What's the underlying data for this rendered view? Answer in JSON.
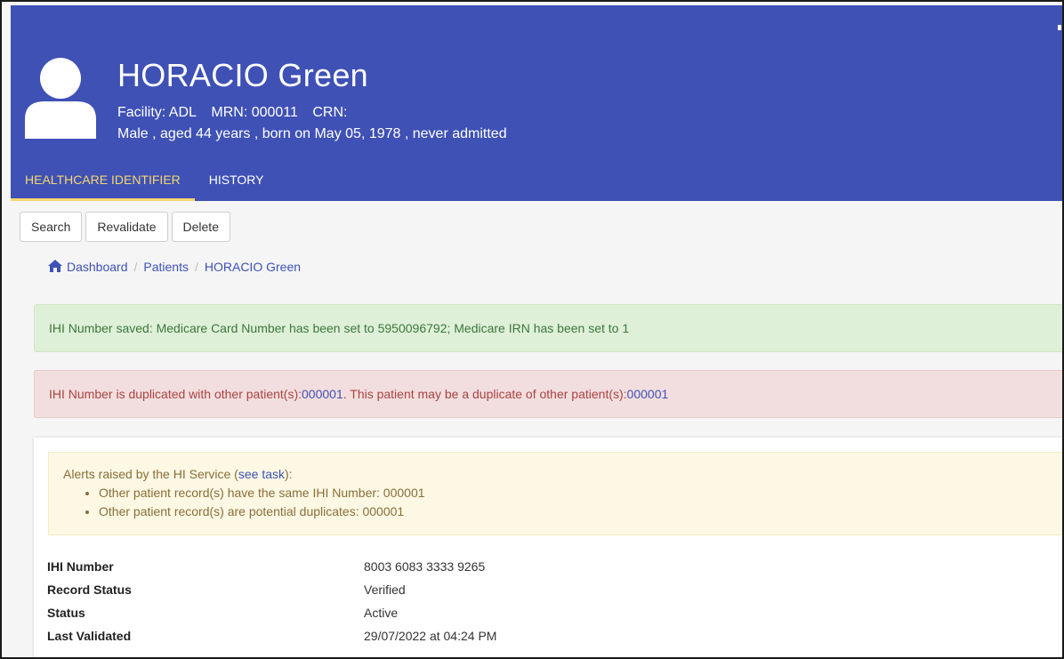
{
  "patient": {
    "name": "HORACIO Green",
    "facility": "Facility: ADL",
    "mrn": "MRN: 000011",
    "crn": "CRN:",
    "summary": "Male , aged 44 years , born on May 05, 1978 , never admitted"
  },
  "tabs": [
    {
      "label": "HEALTHCARE IDENTIFIER",
      "active": true
    },
    {
      "label": "HISTORY",
      "active": false
    }
  ],
  "toolbar": {
    "search_label": "Search",
    "revalidate_label": "Revalidate",
    "delete_label": "Delete"
  },
  "breadcrumb": {
    "home": "Dashboard",
    "patients": "Patients",
    "current": "HORACIO Green"
  },
  "alerts": {
    "success": "IHI Number saved: Medicare Card Number has been set to 5950096792; Medicare IRN has been set to 1",
    "danger_prefix": "IHI Number is duplicated with other patient(s): ",
    "danger_link1": "000001",
    "danger_middle": ". This patient may be a duplicate of other patient(s): ",
    "danger_link2": "000001"
  },
  "hi_service": {
    "intro_prefix": "Alerts raised by the HI Service (",
    "intro_link": "see task",
    "intro_suffix": "):",
    "items": [
      "Other patient record(s) have the same IHI Number: 000001",
      "Other patient record(s) are potential duplicates: 000001"
    ]
  },
  "details": [
    {
      "label": "IHI Number",
      "value": "8003 6083 3333 9265"
    },
    {
      "label": "Record Status",
      "value": "Verified"
    },
    {
      "label": "Status",
      "value": "Active"
    },
    {
      "label": "Last Validated",
      "value": "29/07/2022 at 04:24 PM"
    }
  ],
  "colors": {
    "header_bg": "#3f51b5",
    "active_tab": "#f5d76e",
    "link": "#3f51b5",
    "success_bg": "#dff0d8",
    "danger_bg": "#f2dede",
    "warning_bg": "#fcf8e3"
  },
  "icons": {
    "avatar": "person-avatar-icon",
    "home": "home-icon"
  }
}
